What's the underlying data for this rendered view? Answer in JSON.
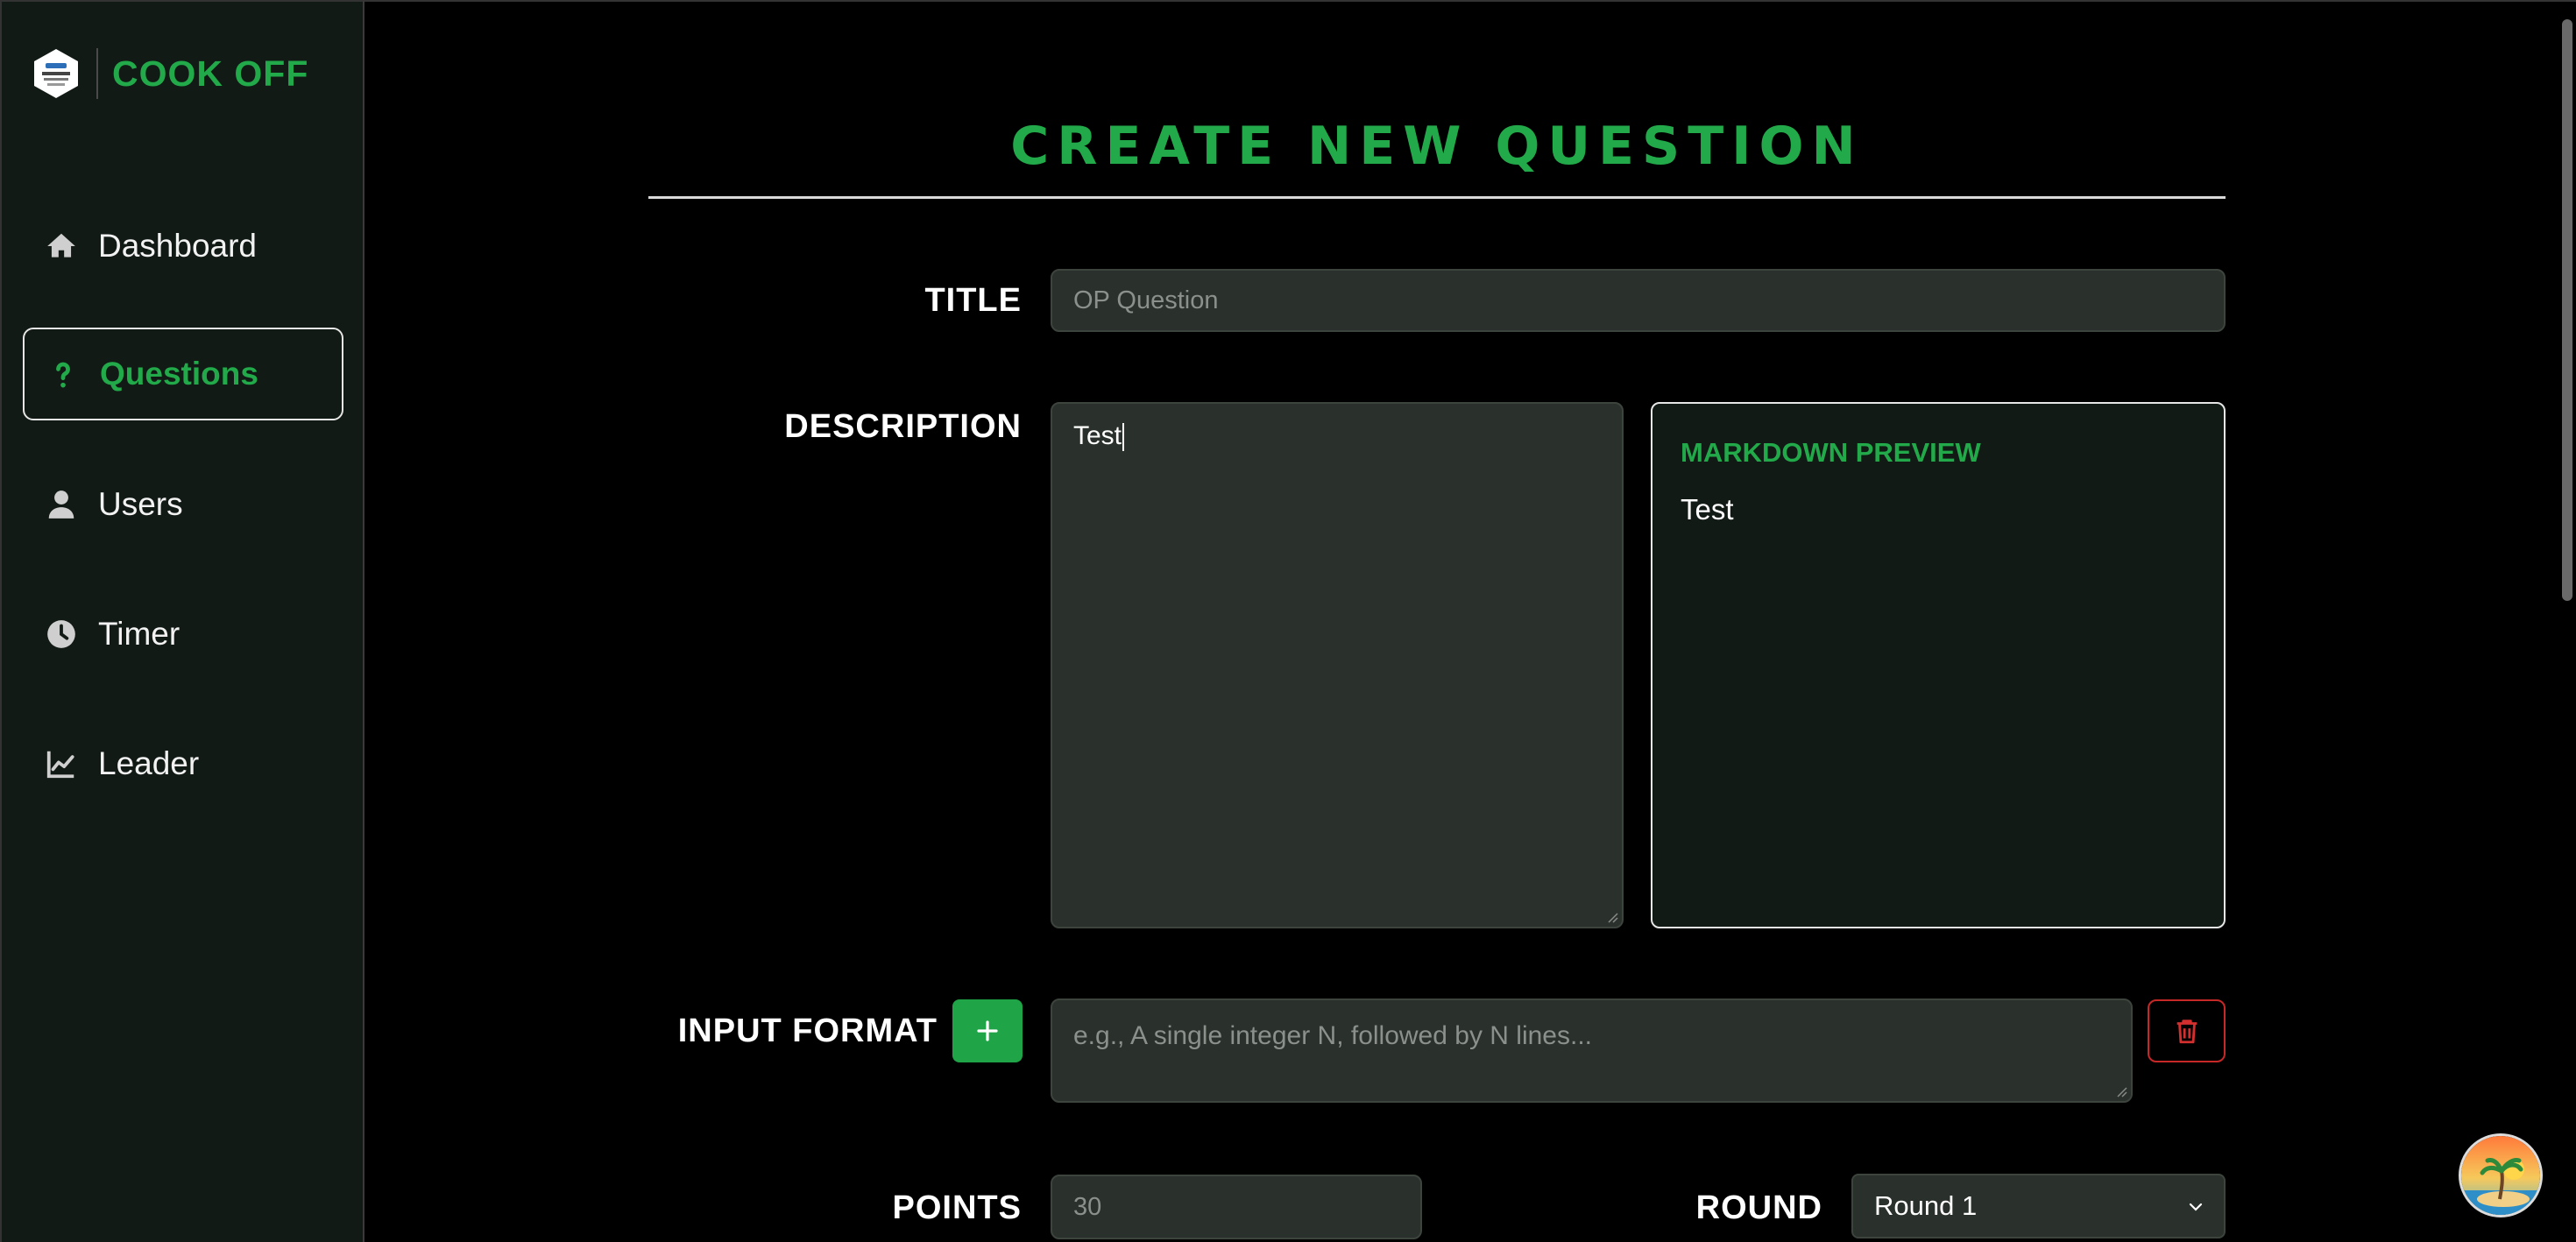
{
  "app": {
    "name": "COOK OFF"
  },
  "sidebar": {
    "items": [
      {
        "label": "Dashboard",
        "icon": "home-icon",
        "active": false
      },
      {
        "label": "Questions",
        "icon": "question-icon",
        "active": true
      },
      {
        "label": "Users",
        "icon": "user-icon",
        "active": false
      },
      {
        "label": "Timer",
        "icon": "clock-icon",
        "active": false
      },
      {
        "label": "Leader",
        "icon": "chart-line-icon",
        "active": false
      }
    ]
  },
  "page": {
    "title": "CREATE NEW QUESTION"
  },
  "form": {
    "title_label": "TITLE",
    "title_placeholder": "OP Question",
    "title_value": "",
    "description_label": "DESCRIPTION",
    "description_value": "Test",
    "preview_title": "MARKDOWN PREVIEW",
    "preview_body": "Test",
    "input_format_label": "INPUT FORMAT",
    "input_format_placeholder": "e.g., A single integer N, followed by N lines...",
    "points_label": "POINTS",
    "points_placeholder": "30",
    "round_label": "ROUND",
    "round_value": "Round 1"
  },
  "colors": {
    "accent": "#22a94a",
    "sidebar_bg": "#111a15",
    "field_bg": "#2a302b",
    "danger": "#c62828"
  }
}
